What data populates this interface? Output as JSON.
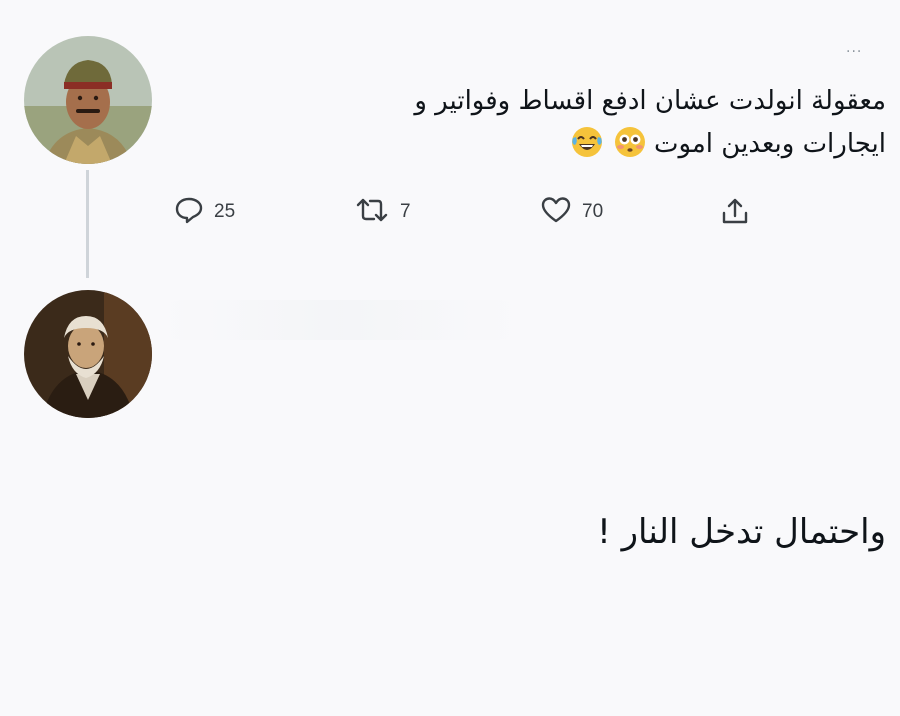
{
  "tweet": {
    "line1": "معقولة انولدت عشان ادفع اقساط وفواتير و",
    "line2": "ايجارات وبعدين اموت",
    "emojis": [
      "flushed-face",
      "tears-of-joy-face"
    ],
    "more_label": "..."
  },
  "actions": {
    "reply_count": "25",
    "retweet_count": "7",
    "like_count": "70"
  },
  "reply": {
    "text": "واحتمال تدخل النار !"
  },
  "colors": {
    "background": "#f9f9fb",
    "text": "#0f1419",
    "icon": "#536471",
    "thread_line": "#cfd4d9"
  }
}
